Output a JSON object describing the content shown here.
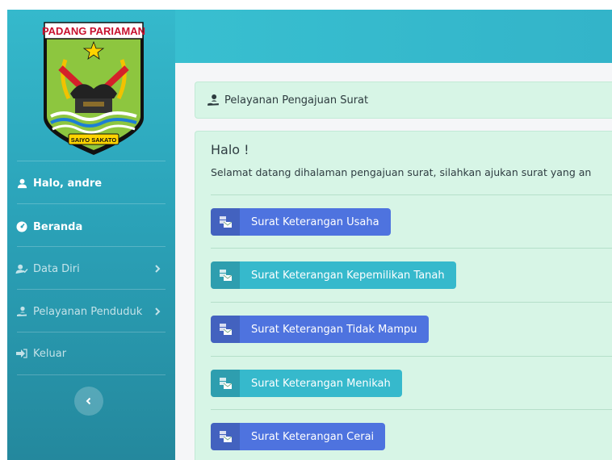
{
  "sidebar": {
    "logo": {
      "banner_text": "PADANG PARIAMAN",
      "ribbon_text": "SAIYO SAKATO"
    },
    "user_greeting": "Halo, andre",
    "items": [
      {
        "label": "Beranda",
        "icon": "dashboard-icon",
        "has_submenu": false
      },
      {
        "label": "Data Diri",
        "icon": "user-check-icon",
        "has_submenu": true
      },
      {
        "label": "Pelayanan Penduduk",
        "icon": "hand-user-icon",
        "has_submenu": true
      },
      {
        "label": "Keluar",
        "icon": "sign-out-icon",
        "has_submenu": false
      }
    ],
    "toggle_icon": "chevron-left-icon"
  },
  "breadcrumb": {
    "icon": "hand-user-icon",
    "label": "Pelayanan Pengajuan Surat"
  },
  "panel": {
    "greeting": "Halo !",
    "welcome": "Selamat datang dihalaman pengajuan surat, silahkan ajukan surat yang an",
    "buttons": [
      {
        "label": "Surat Keterangan Usaha",
        "color": "#4e73df",
        "icon": "mail-bulk-icon"
      },
      {
        "label": "Surat Keterangan Kepemilikan Tanah",
        "color": "#36b9cc",
        "icon": "mail-bulk-icon"
      },
      {
        "label": "Surat Keterangan Tidak Mampu",
        "color": "#4e73df",
        "icon": "mail-bulk-icon"
      },
      {
        "label": "Surat Keterangan Menikah",
        "color": "#36b9cc",
        "icon": "mail-bulk-icon"
      },
      {
        "label": "Surat Keterangan Cerai",
        "color": "#4e73df",
        "icon": "mail-bulk-icon"
      }
    ]
  },
  "colors": {
    "primary": "#4e73df",
    "info": "#36b9cc",
    "panel_bg": "#d7f5e6",
    "sidebar_top": "#35b9cc",
    "sidebar_bottom": "#24889d"
  }
}
